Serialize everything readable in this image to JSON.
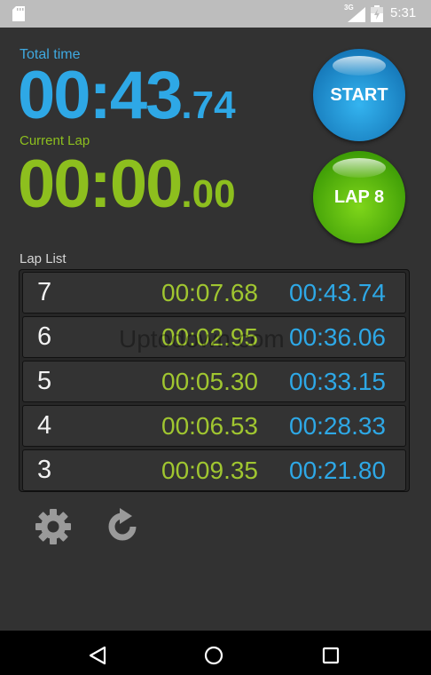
{
  "status_bar": {
    "time": "5:31",
    "network": "3G"
  },
  "total_time": {
    "label": "Total time",
    "main": "00:43",
    "fraction": ".74"
  },
  "current_lap": {
    "label": "Current Lap",
    "main": "00:00",
    "fraction": ".00"
  },
  "buttons": {
    "start_label": "START",
    "lap_label": "LAP 8"
  },
  "lap_list": {
    "label": "Lap List",
    "rows": [
      {
        "number": "7",
        "split": "00:07.68",
        "total": "00:43.74"
      },
      {
        "number": "6",
        "split": "00:02.95",
        "total": "00:36.06"
      },
      {
        "number": "5",
        "split": "00:05.30",
        "total": "00:33.15"
      },
      {
        "number": "4",
        "split": "00:06.53",
        "total": "00:28.33"
      },
      {
        "number": "3",
        "split": "00:09.35",
        "total": "00:21.80"
      }
    ]
  },
  "watermark": "Uptodown.com",
  "colors": {
    "total_blue": "#2ea8e6",
    "lap_green": "#8dbf1e",
    "background": "#323232"
  },
  "icons": {
    "settings": "gear-icon",
    "reset": "refresh-icon"
  }
}
